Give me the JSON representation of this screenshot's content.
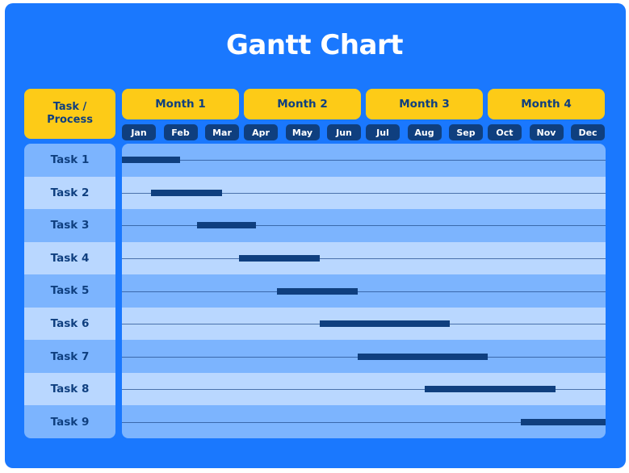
{
  "title": "Gantt Chart",
  "header": {
    "task_column": "Task / Process",
    "months_groups": [
      "Month 1",
      "Month 2",
      "Month 3",
      "Month 4"
    ],
    "months": [
      "Jan",
      "Feb",
      "Mar",
      "Apr",
      "May",
      "Jun",
      "Jul",
      "Aug",
      "Sep",
      "Oct",
      "Nov",
      "Dec"
    ]
  },
  "colors": {
    "background": "#1a78fe",
    "header_yellow": "#fdcb17",
    "navy": "#0f3f7f",
    "row_dark": "#7cb4fe",
    "row_light": "#b9d7ff",
    "title_text": "#ffffff"
  },
  "chart_data": {
    "type": "gantt",
    "title": "Gantt Chart",
    "xlabel": "",
    "ylabel": "Task / Process",
    "x_unit": "months",
    "xlim": [
      0,
      12
    ],
    "categories": [
      "Task 1",
      "Task 2",
      "Task 3",
      "Task 4",
      "Task 5",
      "Task 6",
      "Task 7",
      "Task 8",
      "Task 9"
    ],
    "tasks": [
      {
        "name": "Task 1",
        "start": 0.0,
        "end": 1.45
      },
      {
        "name": "Task 2",
        "start": 0.72,
        "end": 2.48
      },
      {
        "name": "Task 3",
        "start": 1.86,
        "end": 3.32
      },
      {
        "name": "Task 4",
        "start": 2.9,
        "end": 4.9
      },
      {
        "name": "Task 5",
        "start": 3.84,
        "end": 5.84
      },
      {
        "name": "Task 6",
        "start": 4.9,
        "end": 8.14
      },
      {
        "name": "Task 7",
        "start": 5.84,
        "end": 9.08
      },
      {
        "name": "Task 8",
        "start": 7.52,
        "end": 10.76
      },
      {
        "name": "Task 9",
        "start": 9.9,
        "end": 12.0
      }
    ],
    "x_tick_labels": [
      "Jan",
      "Feb",
      "Mar",
      "Apr",
      "May",
      "Jun",
      "Jul",
      "Aug",
      "Sep",
      "Oct",
      "Nov",
      "Dec"
    ],
    "x_group_labels": [
      "Month 1",
      "Month 2",
      "Month 3",
      "Month 4"
    ],
    "grid": true,
    "legend": "none"
  }
}
